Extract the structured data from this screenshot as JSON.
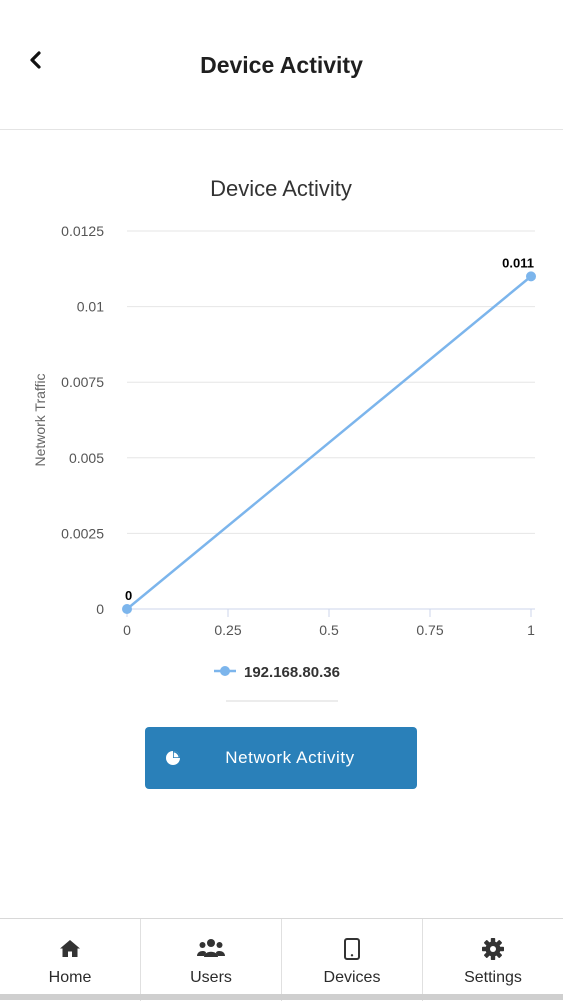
{
  "header": {
    "title": "Device Activity",
    "back_icon": "chevron-left-icon"
  },
  "chart_data": {
    "type": "line",
    "title": "Device Activity",
    "xlabel": "",
    "ylabel": "Network Traffic",
    "x": [
      0,
      1
    ],
    "x_ticks": [
      "0",
      "0.25",
      "0.5",
      "0.75",
      "1"
    ],
    "y_ticks": [
      "0",
      "0.0025",
      "0.005",
      "0.0075",
      "0.01",
      "0.0125"
    ],
    "xlim": [
      0,
      1
    ],
    "ylim": [
      0,
      0.0125
    ],
    "grid": true,
    "legend_position": "bottom",
    "series": [
      {
        "name": "192.168.80.36",
        "values": [
          0,
          0.011
        ],
        "data_labels": [
          "0",
          "0.011"
        ],
        "color": "#7cb5ec"
      }
    ]
  },
  "action_button": {
    "label": "Network Activity",
    "icon": "pie-chart-icon",
    "color": "#2a80b9"
  },
  "tabs": [
    {
      "label": "Home",
      "icon": "home-icon"
    },
    {
      "label": "Users",
      "icon": "users-icon"
    },
    {
      "label": "Devices",
      "icon": "tablet-icon"
    },
    {
      "label": "Settings",
      "icon": "gear-icon"
    }
  ]
}
